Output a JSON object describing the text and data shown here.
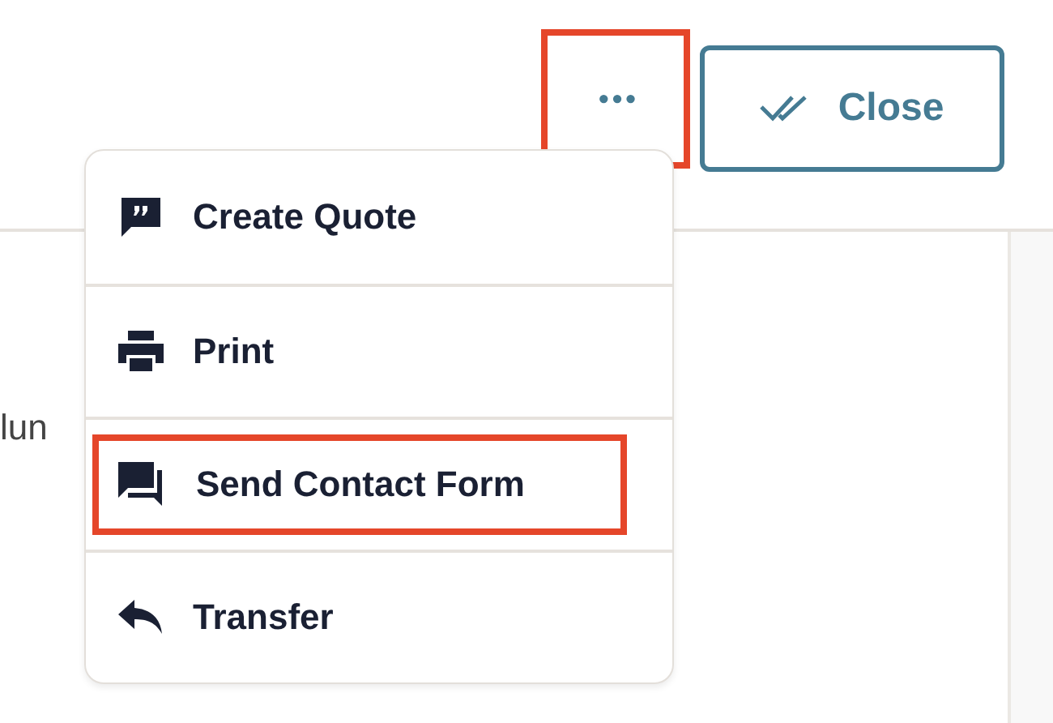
{
  "header": {
    "more_button": {
      "label": "•••",
      "highlighted": true
    },
    "close_button": {
      "label": "Close"
    }
  },
  "body": {
    "text": "lun"
  },
  "menu": {
    "items": [
      {
        "kind": "quote",
        "label": "Create Quote",
        "highlighted": false
      },
      {
        "kind": "print",
        "label": "Print",
        "highlighted": false
      },
      {
        "kind": "chat",
        "label": "Send Contact Form",
        "highlighted": true
      },
      {
        "kind": "reply",
        "label": "Transfer",
        "highlighted": false
      }
    ]
  }
}
